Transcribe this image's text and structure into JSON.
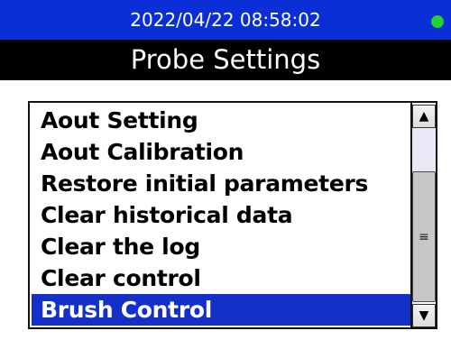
{
  "status_bar": {
    "datetime": "2022/04/22   08:58:02",
    "led_color": "#22d133",
    "background_color": "#0a2fd6"
  },
  "title_bar": {
    "title": "Probe Settings",
    "background_color": "#000000"
  },
  "menu": {
    "items": [
      {
        "label": "Aout Setting",
        "selected": false
      },
      {
        "label": "Aout Calibration",
        "selected": false
      },
      {
        "label": "Restore initial parameters",
        "selected": false
      },
      {
        "label": "Clear historical data",
        "selected": false
      },
      {
        "label": "Clear the log",
        "selected": false
      },
      {
        "label": "Clear control",
        "selected": false
      },
      {
        "label": "Brush Control",
        "selected": true
      }
    ],
    "selected_index": 6,
    "selected_color": "#1330c9"
  },
  "scrollbar": {
    "up_icon": "triangle-up-icon",
    "down_icon": "triangle-down-icon",
    "grip_icon": "grip-lines-icon",
    "up_glyph": "▲",
    "down_glyph": "▼",
    "grip_glyph": "≡"
  }
}
